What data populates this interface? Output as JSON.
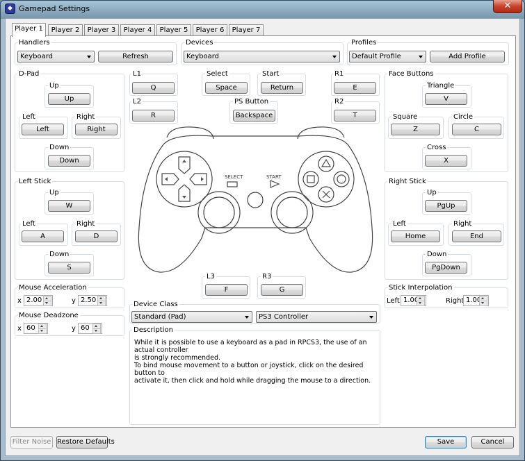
{
  "window": {
    "title": "Gamepad Settings",
    "close_glyph": "✕",
    "app_icon_glyph": "◆"
  },
  "tabs": [
    "Player 1",
    "Player 2",
    "Player 3",
    "Player 4",
    "Player 5",
    "Player 6",
    "Player 7"
  ],
  "active_tab": "Player 1",
  "handlers": {
    "title": "Handlers",
    "selected": "Keyboard",
    "refresh_label": "Refresh"
  },
  "devices": {
    "title": "Devices",
    "selected": "Keyboard"
  },
  "profiles": {
    "title": "Profiles",
    "selected": "Default Profile",
    "add_label": "Add Profile"
  },
  "dpad": {
    "title": "D-Pad",
    "up": {
      "label": "Up",
      "key": "Up"
    },
    "left": {
      "label": "Left",
      "key": "Left"
    },
    "right": {
      "label": "Right",
      "key": "Right"
    },
    "down": {
      "label": "Down",
      "key": "Down"
    }
  },
  "left_stick": {
    "title": "Left Stick",
    "up": {
      "label": "Up",
      "key": "W"
    },
    "left": {
      "label": "Left",
      "key": "A"
    },
    "right": {
      "label": "Right",
      "key": "D"
    },
    "down": {
      "label": "Down",
      "key": "S"
    }
  },
  "mouse_accel": {
    "title": "Mouse Acceleration",
    "x_label": "x",
    "x": "2.00",
    "y_label": "y",
    "y": "2.50"
  },
  "mouse_deadzone": {
    "title": "Mouse Deadzone",
    "x_label": "x",
    "x": "60",
    "y_label": "y",
    "y": "60"
  },
  "shoulder": {
    "l1": {
      "label": "L1",
      "key": "Q"
    },
    "l2": {
      "label": "L2",
      "key": "R"
    },
    "r1": {
      "label": "R1",
      "key": "E"
    },
    "r2": {
      "label": "R2",
      "key": "T"
    }
  },
  "center": {
    "select": {
      "label": "Select",
      "key": "Space"
    },
    "start": {
      "label": "Start",
      "key": "Return"
    },
    "ps": {
      "label": "PS Button",
      "key": "Backspace"
    }
  },
  "controller_image": {
    "select_text": "SELECT",
    "start_text": "START"
  },
  "sticks_press": {
    "l3": {
      "label": "L3",
      "key": "F"
    },
    "r3": {
      "label": "R3",
      "key": "G"
    }
  },
  "device_class": {
    "title": "Device Class",
    "selected": "Standard (Pad)",
    "type_selected": "PS3 Controller"
  },
  "description": {
    "title": "Description",
    "lines": [
      "While it is possible to use a keyboard as a pad in RPCS3, the use of an actual controller",
      "is strongly recommended.",
      "To bind mouse movement to a button or joystick, click on the desired button to",
      "activate it, then click and hold while dragging the mouse to a direction."
    ]
  },
  "face_buttons": {
    "title": "Face Buttons",
    "triangle": {
      "label": "Triangle",
      "key": "V"
    },
    "square": {
      "label": "Square",
      "key": "Z"
    },
    "circle": {
      "label": "Circle",
      "key": "C"
    },
    "cross": {
      "label": "Cross",
      "key": "X"
    }
  },
  "right_stick": {
    "title": "Right Stick",
    "up": {
      "label": "Up",
      "key": "PgUp"
    },
    "left": {
      "label": "Left",
      "key": "Home"
    },
    "right": {
      "label": "Right",
      "key": "End"
    },
    "down": {
      "label": "Down",
      "key": "PgDown"
    }
  },
  "stick_interp": {
    "title": "Stick Interpolation",
    "left_label": "Left",
    "left": "1.00",
    "right_label": "Right",
    "right": "1.00"
  },
  "footer": {
    "filter_noise": "Filter Noise",
    "restore": "Restore Defaults",
    "save": "Save",
    "cancel": "Cancel"
  },
  "colors": {
    "close_red": "#c6422c",
    "pane_white": "#ffffff",
    "dialog_gray": "#f0f0f0"
  }
}
